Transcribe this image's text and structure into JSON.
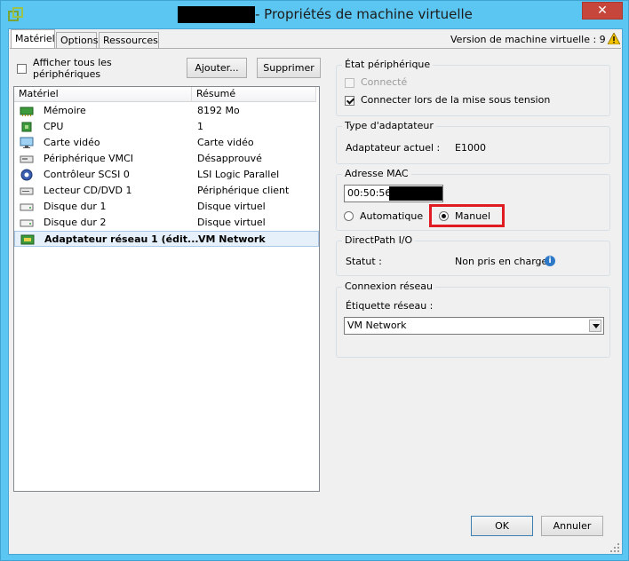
{
  "window": {
    "title": "- Propriétés de machine virtuelle",
    "close_symbol": "✕",
    "version_text": "Version de machine virtuelle : 9"
  },
  "tabs": [
    {
      "label": "Matériel",
      "active": true
    },
    {
      "label": "Options",
      "active": false
    },
    {
      "label": "Ressources",
      "active": false
    }
  ],
  "hardware": {
    "show_all_label": "Afficher tous les périphériques",
    "show_all_line1": "Afficher tous les",
    "show_all_line2": "périphériques",
    "add_button": "Ajouter...",
    "remove_button": "Supprimer",
    "columns": [
      "Matériel",
      "Résumé"
    ],
    "rows": [
      {
        "name": "Mémoire",
        "summary": "8192 Mo",
        "icon": "memory-icon"
      },
      {
        "name": "CPU",
        "summary": "1",
        "icon": "cpu-icon"
      },
      {
        "name": "Carte vidéo",
        "summary": "Carte vidéo",
        "icon": "monitor-icon"
      },
      {
        "name": "Périphérique VMCI",
        "summary": "Désapprouvé",
        "icon": "device-icon"
      },
      {
        "name": "Contrôleur SCSI 0",
        "summary": "LSI Logic Parallel",
        "icon": "scsi-icon"
      },
      {
        "name": "Lecteur CD/DVD 1",
        "summary": "Périphérique client",
        "icon": "cd-drive-icon"
      },
      {
        "name": "Disque dur 1",
        "summary": "Disque virtuel",
        "icon": "disk-icon"
      },
      {
        "name": "Disque dur 2",
        "summary": "Disque virtuel",
        "icon": "disk-icon"
      },
      {
        "name": "Adaptateur réseau 1 (édit...",
        "summary": "VM Network",
        "icon": "network-adapter-icon",
        "selected": true
      }
    ]
  },
  "device_status": {
    "legend": "État périphérique",
    "connected_label": "Connecté",
    "connected_checked": false,
    "connect_on_power_label": "Connecter lors de la mise sous tension",
    "connect_on_power_checked": true
  },
  "adapter_type": {
    "legend": "Type d'adaptateur",
    "current_label": "Adaptateur actuel :",
    "current_value": "E1000"
  },
  "mac_address": {
    "legend": "Adresse MAC",
    "value": "00:50:56:",
    "automatic_label": "Automatique",
    "manual_label": "Manuel",
    "selected": "manual"
  },
  "directpath": {
    "legend": "DirectPath I/O",
    "status_label": "Statut :",
    "status_value": "Non pris en charge"
  },
  "network_connection": {
    "legend": "Connexion réseau",
    "label": "Étiquette réseau :",
    "value": "VM Network"
  },
  "footer": {
    "ok_button": "OK",
    "cancel_button": "Annuler"
  },
  "colors": {
    "title_bar": "#5cc6f2",
    "close_button": "#c7463c",
    "highlight": "#e01b22",
    "selected_row": "#e6f0fa"
  }
}
